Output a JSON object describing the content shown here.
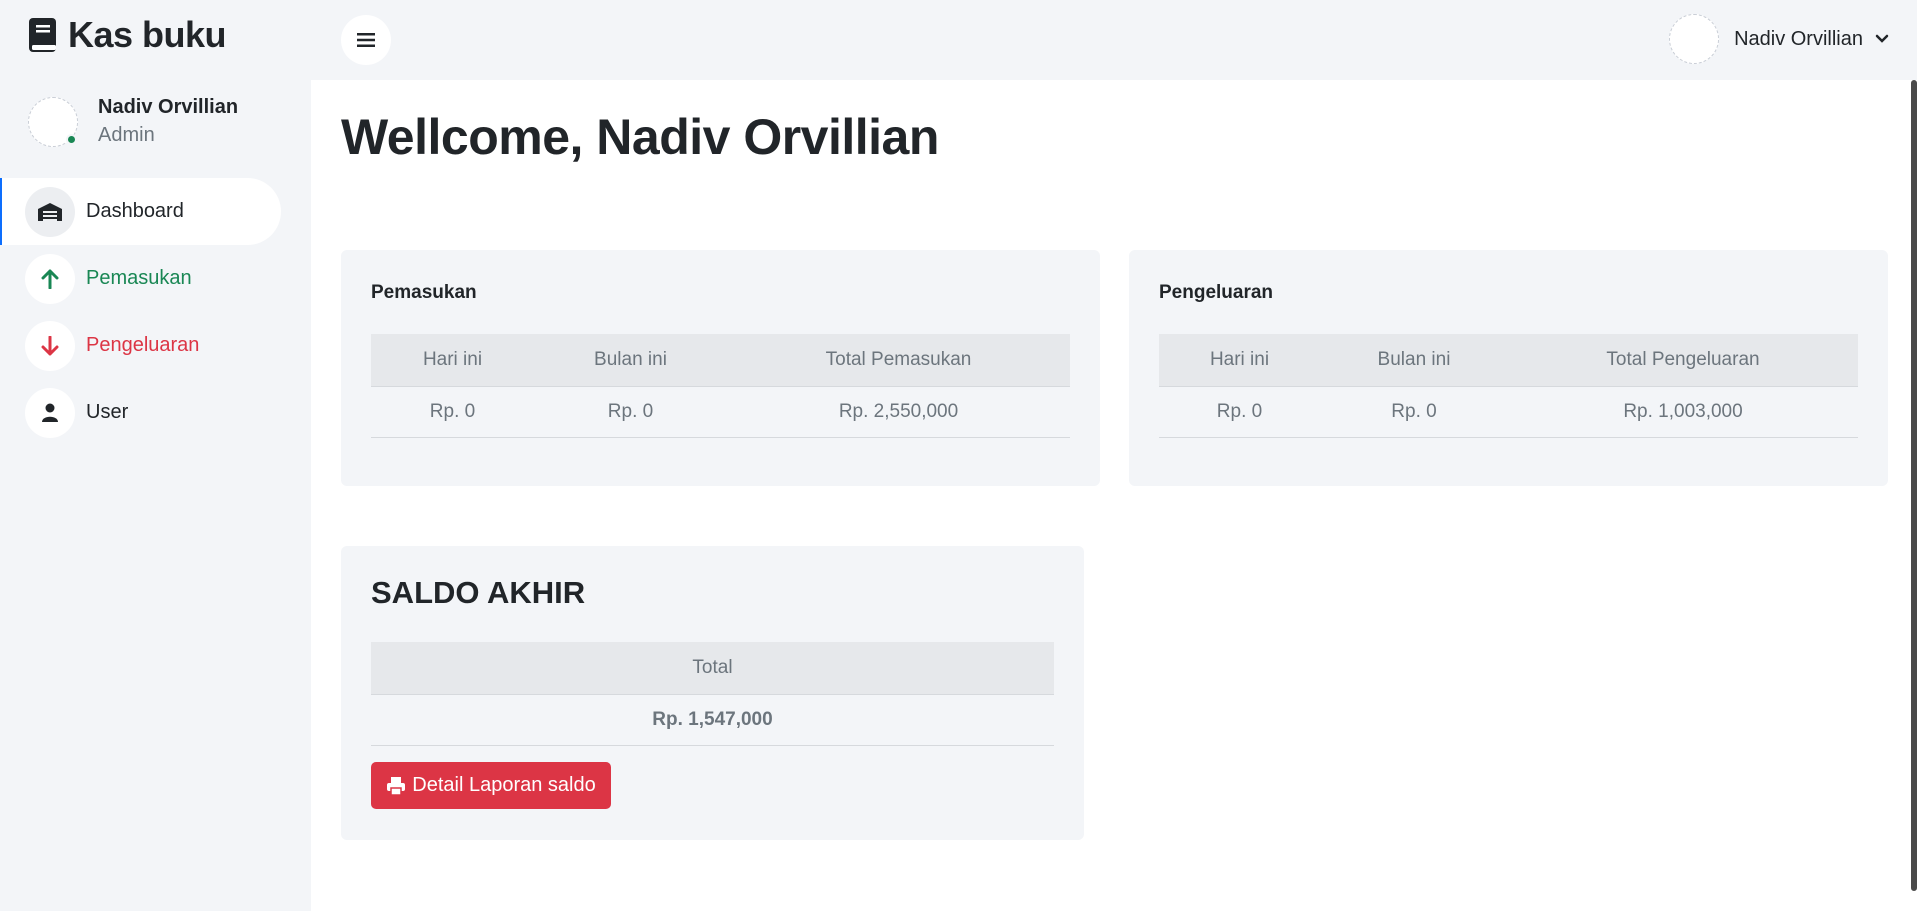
{
  "brand": {
    "title": "Kas buku",
    "icon": "book-icon"
  },
  "profile": {
    "name": "Nadiv Orvillian",
    "role": "Admin",
    "status_color": "#198754"
  },
  "nav": {
    "items": [
      {
        "label": "Dashboard",
        "icon": "dashboard-icon",
        "color": "#212529",
        "active": true
      },
      {
        "label": "Pemasukan",
        "icon": "arrow-up-icon",
        "color": "#198754"
      },
      {
        "label": "Pengeluaran",
        "icon": "arrow-down-icon",
        "color": "#dc3545"
      },
      {
        "label": "User",
        "icon": "user-icon",
        "color": "#212529"
      }
    ]
  },
  "topbar": {
    "user_name": "Nadiv Orvillian"
  },
  "main": {
    "welcome": "Wellcome, Nadiv Orvillian",
    "pemasukan": {
      "title": "Pemasukan",
      "headers": [
        "Hari ini",
        "Bulan ini",
        "Total Pemasukan"
      ],
      "values": [
        "Rp. 0",
        "Rp. 0",
        "Rp. 2,550,000"
      ]
    },
    "pengeluaran": {
      "title": "Pengeluaran",
      "headers": [
        "Hari ini",
        "Bulan ini",
        "Total Pengeluaran"
      ],
      "values": [
        "Rp. 0",
        "Rp. 0",
        "Rp. 1,003,000"
      ]
    },
    "saldo": {
      "title": "SALDO AKHIR",
      "header": "Total",
      "value": "Rp. 1,547,000",
      "button_label": "Detail Laporan saldo"
    }
  },
  "colors": {
    "accent_red": "#dc3545",
    "accent_green": "#198754",
    "panel_bg": "#f3f5f8"
  }
}
